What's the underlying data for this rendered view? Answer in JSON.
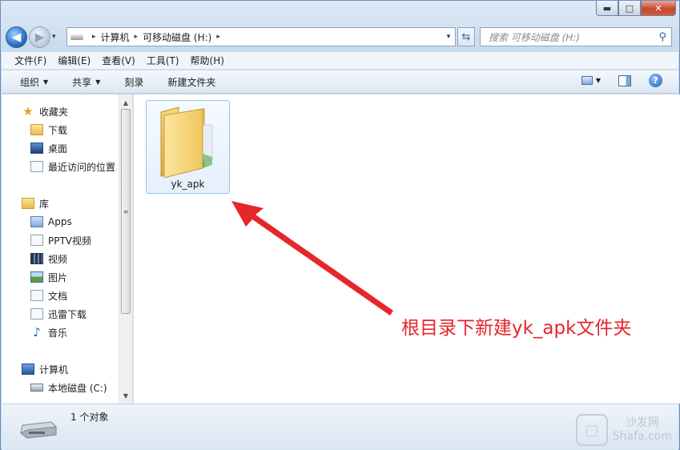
{
  "window": {
    "caption": {
      "minimize": "▬",
      "maximize": "□",
      "close": "✕"
    }
  },
  "nav": {
    "back": "◀",
    "forward": "▶",
    "recent": "▾"
  },
  "address": {
    "crumbs": [
      "计算机",
      "可移动磁盘 (H:)"
    ],
    "separator": "▸",
    "dropdown": "▾",
    "refresh": "⇆"
  },
  "search": {
    "placeholder": "搜索 可移动磁盘 (H:)",
    "icon": "⚲"
  },
  "menu": {
    "items": [
      "文件(F)",
      "编辑(E)",
      "查看(V)",
      "工具(T)",
      "帮助(H)"
    ]
  },
  "commands": {
    "organize": "组织",
    "share": "共享",
    "burn": "刻录",
    "new_folder": "新建文件夹",
    "caret": "▼",
    "help": "?"
  },
  "sidebar": {
    "favorites": {
      "label": "收藏夹",
      "items": [
        "下载",
        "桌面",
        "最近访问的位置"
      ]
    },
    "libraries": {
      "label": "库",
      "items": [
        "Apps",
        "PPTV视频",
        "视频",
        "图片",
        "文档",
        "迅雷下载",
        "音乐"
      ]
    },
    "computer": {
      "label": "计算机",
      "items": [
        "本地磁盘 (C:)"
      ]
    }
  },
  "scroll": {
    "up": "▲",
    "down": "▼",
    "grip": "≡"
  },
  "content": {
    "folder_name": "yk_apk",
    "annotation": "根目录下新建yk_apk文件夹"
  },
  "details": {
    "count": "1 个对象"
  },
  "watermark": {
    "line1": "沙发网",
    "line2": "Shafa.com",
    "glyph": "▢"
  },
  "colors": {
    "annotation": "#e5262a",
    "selection": "#99bfe6"
  }
}
